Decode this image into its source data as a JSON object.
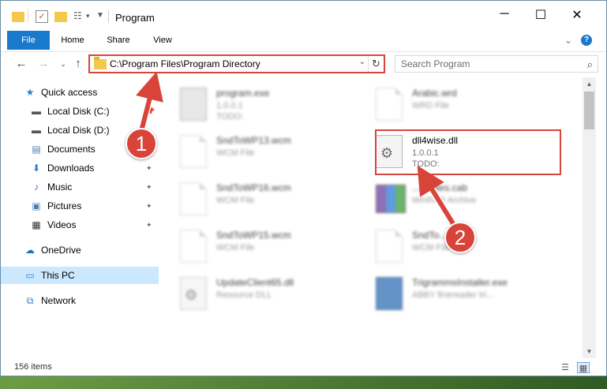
{
  "window": {
    "title": "Program",
    "controls": {
      "minimize": "─",
      "maximize": "☐",
      "close": "✕"
    }
  },
  "ribbon": {
    "tabs": [
      {
        "label": "File",
        "active": true
      },
      {
        "label": "Home"
      },
      {
        "label": "Share"
      },
      {
        "label": "View"
      }
    ],
    "help": "?"
  },
  "address": {
    "path": "C:\\Program Files\\Program Directory"
  },
  "search": {
    "placeholder": "Search Program"
  },
  "nav_pane": {
    "items": [
      {
        "label": "Quick access",
        "icon": "star-icon",
        "color": "#2b7cd3"
      },
      {
        "label": "Local Disk (C:)",
        "icon": "drive-icon"
      },
      {
        "label": "Local Disk (D:)",
        "icon": "drive-icon"
      },
      {
        "label": "Documents",
        "icon": "documents-icon"
      },
      {
        "label": "Downloads",
        "icon": "download-icon"
      },
      {
        "label": "Music",
        "icon": "music-icon"
      },
      {
        "label": "Pictures",
        "icon": "pictures-icon"
      },
      {
        "label": "Videos",
        "icon": "videos-icon"
      },
      {
        "label": "OneDrive",
        "icon": "cloud-icon"
      },
      {
        "label": "This PC",
        "icon": "computer-icon",
        "selected": true
      },
      {
        "label": "Network",
        "icon": "network-icon"
      }
    ]
  },
  "files": [
    {
      "name": "program.exe",
      "sub1": "1.0.0.1",
      "sub2": "TODO:",
      "icon": "exe-icon",
      "blurred": true
    },
    {
      "name": "Arabic.wrd",
      "sub1": "WRD File",
      "sub2": "",
      "icon": "document-icon",
      "blurred": true
    },
    {
      "name": "SndToWP13.wcm",
      "sub1": "WCM File",
      "sub2": "",
      "icon": "document-icon",
      "blurred": true
    },
    {
      "name": "dll4wise.dll",
      "sub1": "1.0.0.1",
      "sub2": "TODO:",
      "icon": "gear-document-icon",
      "blurred": false
    },
    {
      "name": "SndToWP16.wcm",
      "sub1": "WCM File",
      "sub2": "",
      "icon": "document-icon",
      "blurred": true
    },
    {
      "name": "...ificates.cab",
      "sub1": "WinRAR Archive",
      "sub2": "",
      "icon": "archive-icon",
      "blurred": true
    },
    {
      "name": "SndToWP15.wcm",
      "sub1": "WCM File",
      "sub2": "",
      "icon": "document-icon",
      "blurred": true
    },
    {
      "name": "SndTo...wcm",
      "sub1": "WCM File",
      "sub2": "",
      "icon": "document-icon",
      "blurred": true
    },
    {
      "name": "UpdateClient65.dll",
      "sub1": "Resource DLL",
      "sub2": "",
      "icon": "gear-document-icon",
      "blurred": true
    },
    {
      "name": "TrigrammsInstaller.exe",
      "sub1": "ABBY finereader tri...",
      "sub2": "",
      "icon": "installer-icon",
      "blurred": true
    }
  ],
  "status": {
    "item_count": "156 items"
  },
  "callouts": {
    "one": "1",
    "two": "2",
    "color": "#d9443a"
  }
}
